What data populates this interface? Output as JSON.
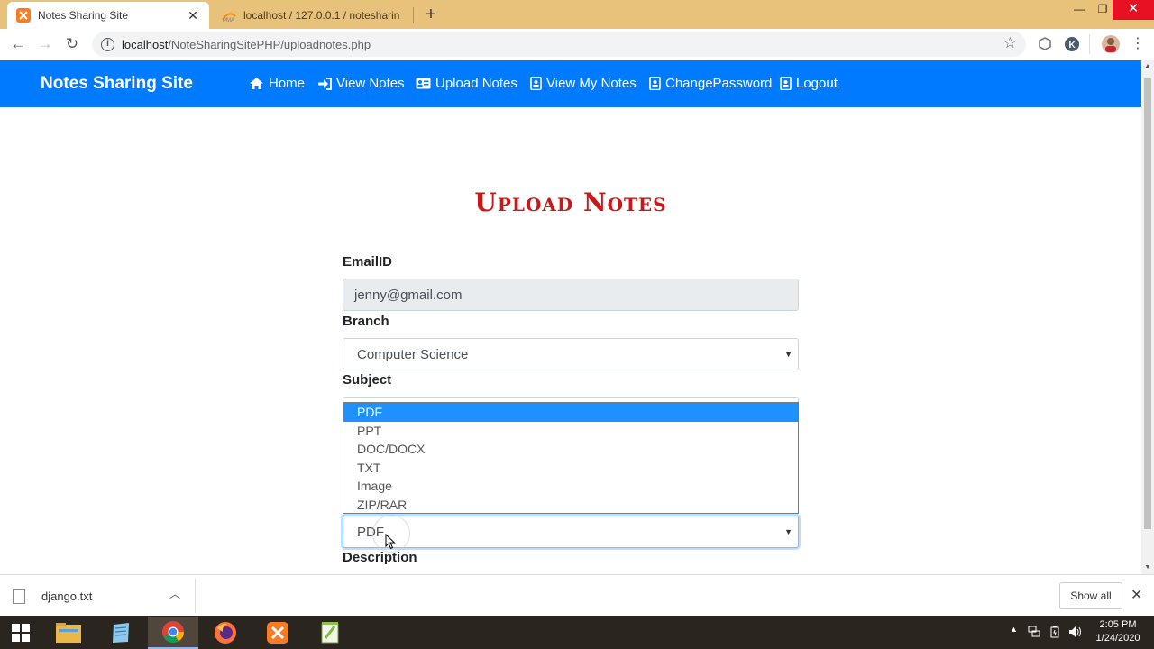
{
  "browser": {
    "tabs": [
      {
        "title": "Notes Sharing Site",
        "active": true
      },
      {
        "title": "localhost / 127.0.0.1 / notesharin",
        "active": false
      }
    ],
    "url_host": "localhost",
    "url_path": "/NoteSharingSitePHP/uploadnotes.php"
  },
  "navbar": {
    "brand": "Notes Sharing Site",
    "items": [
      {
        "label": "Home",
        "icon": "home-icon"
      },
      {
        "label": "View Notes",
        "icon": "sign-in-icon"
      },
      {
        "label": "Upload Notes",
        "icon": "id-card-icon"
      },
      {
        "label": "View My Notes",
        "icon": "contact-book-icon"
      },
      {
        "label": "ChangePassword",
        "icon": "contact-book-icon"
      },
      {
        "label": "Logout",
        "icon": "contact-book-icon"
      }
    ],
    "color": "#007bff"
  },
  "page": {
    "title": "Upload Notes",
    "title_color": "#c81818"
  },
  "form": {
    "email_label": "EmailID",
    "email_value": "jenny@gmail.com",
    "branch_label": "Branch",
    "branch_value": "Computer Science",
    "subject_label": "Subject",
    "filetype_value": "PDF",
    "filetype_options": [
      "PDF",
      "PPT",
      "DOC/DOCX",
      "TXT",
      "Image",
      "ZIP/RAR"
    ],
    "description_label": "Description"
  },
  "downloads": {
    "file": "django.txt",
    "show_all": "Show all"
  },
  "taskbar": {
    "time": "2:05 PM",
    "date": "1/24/2020"
  }
}
